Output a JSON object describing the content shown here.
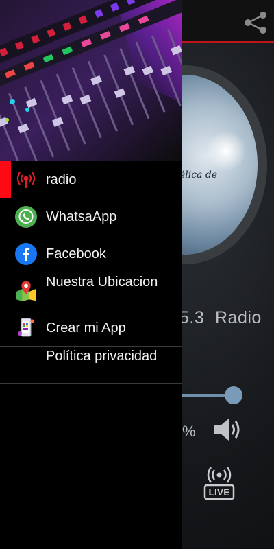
{
  "background_app": {
    "toolbar": {
      "share_icon": "share-icon"
    },
    "cover_art": {
      "caption": "élica de"
    },
    "station": {
      "frequency": "5.3",
      "name": "Radio"
    },
    "seek": {
      "position_fraction": 0.85
    },
    "volume": {
      "percent_text": "%",
      "icon": "volume-icon"
    },
    "live": {
      "label": "LIVE",
      "icon": "broadcast-icon"
    }
  },
  "drawer": {
    "header_image": "audio-mixer-image",
    "items": [
      {
        "label": "radio",
        "icon": "radio-broadcast-icon",
        "active": true
      },
      {
        "label": "WhatsaApp",
        "icon": "whatsapp-icon"
      },
      {
        "label": "Facebook",
        "icon": "facebook-icon"
      },
      {
        "label": "Nuestra Ubicacion",
        "icon": "map-location-icon"
      },
      {
        "label": "Crear mi App",
        "icon": "phone-app-icon"
      },
      {
        "label": "Política privacidad",
        "icon": ""
      }
    ]
  },
  "colors": {
    "accent_red": "#ff0a14",
    "whatsapp_green": "#25d366",
    "facebook_blue": "#1877f2",
    "drawer_bg": "#000000"
  }
}
